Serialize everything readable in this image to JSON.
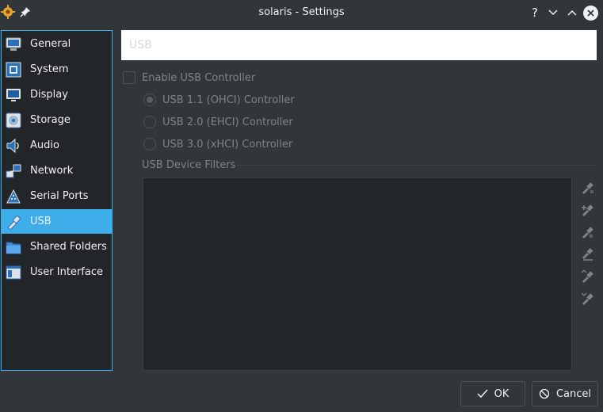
{
  "window": {
    "title": "solaris - Settings",
    "help": "?"
  },
  "sidebar": {
    "items": [
      {
        "label": "General",
        "icon": "monitor-general-icon"
      },
      {
        "label": "System",
        "icon": "chip-icon"
      },
      {
        "label": "Display",
        "icon": "display-icon"
      },
      {
        "label": "Storage",
        "icon": "disk-icon"
      },
      {
        "label": "Audio",
        "icon": "speaker-icon"
      },
      {
        "label": "Network",
        "icon": "network-icon"
      },
      {
        "label": "Serial Ports",
        "icon": "serial-port-icon"
      },
      {
        "label": "USB",
        "icon": "usb-icon",
        "selected": true
      },
      {
        "label": "Shared Folders",
        "icon": "folder-icon"
      },
      {
        "label": "User Interface",
        "icon": "user-interface-icon"
      }
    ]
  },
  "page": {
    "title": "USB",
    "enable_usb": {
      "label": "Enable USB Controller",
      "checked": false
    },
    "controllers": [
      {
        "label": "USB 1.1 (OHCI) Controller",
        "selected": true
      },
      {
        "label": "USB 2.0 (EHCI) Controller",
        "selected": false
      },
      {
        "label": "USB 3.0 (xHCI) Controller",
        "selected": false
      }
    ],
    "filters_label": "USB Device Filters",
    "filter_tools": [
      "add-empty-filter-icon",
      "add-device-filter-icon",
      "edit-filter-icon",
      "remove-filter-icon",
      "move-up-icon",
      "move-down-icon"
    ]
  },
  "buttons": {
    "ok": "OK",
    "cancel": "Cancel"
  },
  "colors": {
    "accent": "#3daee9",
    "background": "#31363b",
    "panel": "#232629"
  }
}
